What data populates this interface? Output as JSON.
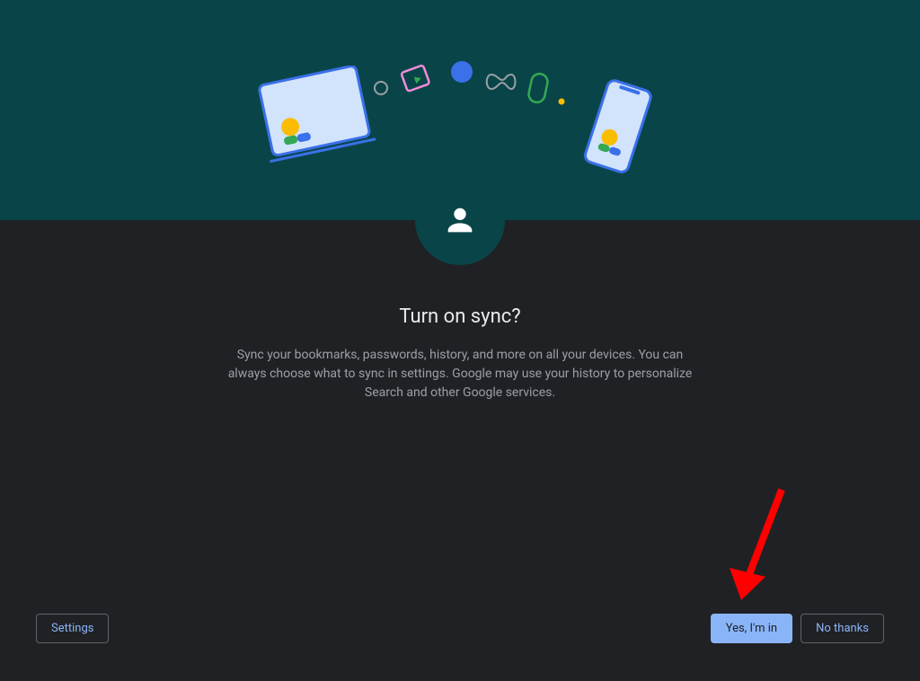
{
  "heading": "Turn on sync?",
  "description": "Sync your bookmarks, passwords, history, and more on all your devices. You can always choose what to sync in settings. Google may use your history to personalize Search and other Google services.",
  "buttons": {
    "settings": "Settings",
    "yes": "Yes, I'm in",
    "no": "No thanks"
  },
  "colors": {
    "hero_bg": "#094548",
    "page_bg": "#202124",
    "accent": "#8ab4f8",
    "arrow": "#ff0000"
  }
}
